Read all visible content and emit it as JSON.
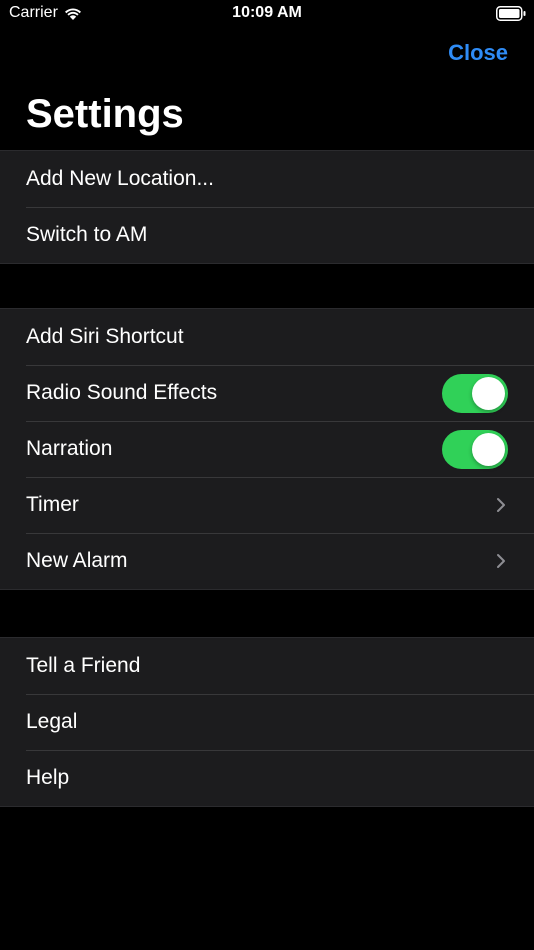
{
  "status_bar": {
    "carrier": "Carrier",
    "time": "10:09 AM",
    "wifi_icon": "wifi-icon",
    "battery_icon": "battery-icon"
  },
  "nav": {
    "close_label": "Close",
    "title": "Settings"
  },
  "colors": {
    "background": "#000000",
    "cell_background": "#1c1c1e",
    "accent": "#2f8cf6",
    "toggle_on": "#30d158"
  },
  "groups": [
    {
      "items": [
        {
          "label": "Add New Location..."
        },
        {
          "label": "Switch to AM"
        }
      ]
    },
    {
      "items": [
        {
          "label": "Add Siri Shortcut"
        },
        {
          "label": "Radio Sound Effects",
          "toggle": true
        },
        {
          "label": "Narration",
          "toggle": true
        },
        {
          "label": "Timer",
          "accessory": "chevron-right-icon"
        },
        {
          "label": "New Alarm",
          "accessory": "chevron-right-icon"
        }
      ]
    },
    {
      "items": [
        {
          "label": "Tell a Friend"
        },
        {
          "label": "Legal"
        },
        {
          "label": "Help"
        }
      ]
    }
  ]
}
